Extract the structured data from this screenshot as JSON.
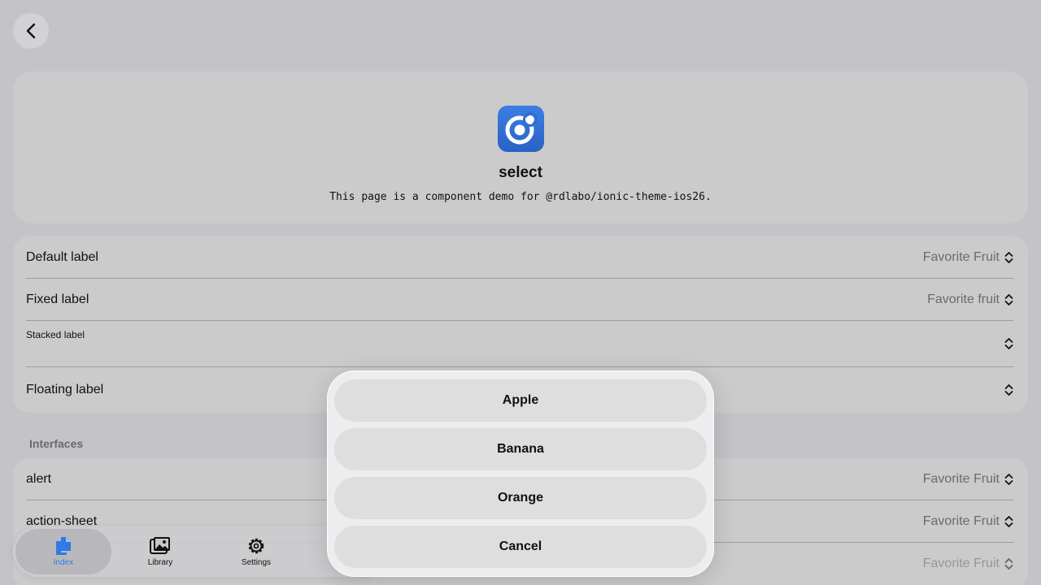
{
  "header": {
    "back_icon": "chevron-left-icon"
  },
  "hero": {
    "icon": "ionic-logo-icon",
    "title": "select",
    "description": "This page is a component demo for @rdlabo/ionic-theme-ios26."
  },
  "label_rows": [
    {
      "label": "Default label",
      "value": "Favorite Fruit"
    },
    {
      "label": "Fixed label",
      "value": "Favorite fruit"
    },
    {
      "label": "Stacked label",
      "value": ""
    },
    {
      "label": "Floating label",
      "value": ""
    }
  ],
  "interfaces": {
    "section_title": "Interfaces",
    "rows": [
      {
        "label": "alert",
        "value": "Favorite Fruit"
      },
      {
        "label": "action-sheet",
        "value": "Favorite Fruit"
      },
      {
        "label": "",
        "value": "Favorite Fruit"
      }
    ]
  },
  "tabbar": {
    "tabs": [
      {
        "label": "Index",
        "icon": "documents-icon",
        "active": true
      },
      {
        "label": "Library",
        "icon": "images-icon",
        "active": false
      },
      {
        "label": "Settings",
        "icon": "gear-icon",
        "active": false
      }
    ]
  },
  "action_sheet": {
    "options": [
      "Apple",
      "Banana",
      "Orange"
    ],
    "cancel": "Cancel"
  },
  "colors": {
    "accent": "#2f7ae5",
    "icon_gradient_top": "#3b7ee3",
    "background": "#c4c3c8"
  }
}
